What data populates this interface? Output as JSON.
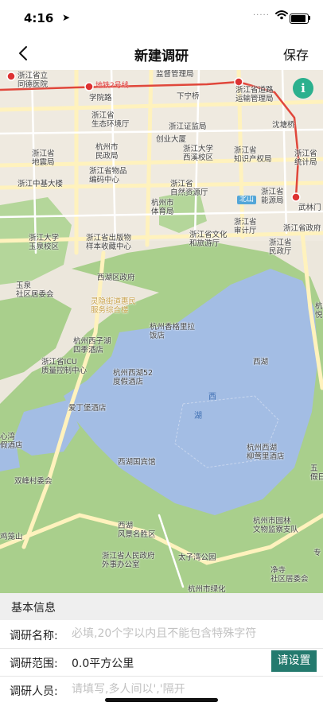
{
  "status_bar": {
    "time": "4:16",
    "location_arrow": "➤",
    "signal": "·····"
  },
  "nav": {
    "back_icon": "chevron-left-icon",
    "title": "新建调研",
    "save_label": "保存"
  },
  "map": {
    "info_label": "i",
    "labels": {
      "tongde": "浙江省立\n同德医院",
      "metro2": "地铁2号线",
      "jianguan": "监督管理局",
      "xuyuan": "学院路",
      "daolu": "浙江省道路\n运输管理局",
      "huanbao": "浙江省\n生态环境厅",
      "xianing": "下宁桥",
      "zhengjian": "浙江证监局",
      "shentang": "沈塘桥",
      "minzheng": "杭州市\n民政局",
      "chuangye": "创业大厦",
      "zju": "浙江大学\n西溪校区",
      "zhishi": "浙江省\n知识产权局",
      "tongji": "浙江省\n统计局",
      "dixiao": "浙江省\n地震局",
      "wuyi": "浙江省物品\n编码中心",
      "zhongji": "浙江中基大楼",
      "ziranziyuan": "浙江省\n自然资源厅",
      "beishan": "北山",
      "nengyuan": "浙江省\n能源局",
      "wulin": "武林门",
      "tiyu": "杭州市\n体育局",
      "shenji": "浙江省\n审计厅",
      "zhengfu": "浙江省政府",
      "yuquan": "浙江大学\n玉泉校区",
      "chuban": "浙江省出版物\n样本收藏中心",
      "wenhua": "浙江省文化\n和旅游厅",
      "minzhengting": "浙江省\n民政厅",
      "yuquan_comm": "玉泉\n社区居委会",
      "xihuqu": "西湖区政府",
      "lingyin": "灵隐街道惠民\n服务综合楼",
      "xiangge": "杭州香格里拉\n饭店",
      "sizi": "杭州西子湖\n四季酒店",
      "icu": "浙江省ICU\n质量控制中心",
      "yuan52": "杭州西湖52\n度假酒店",
      "xihu": "西湖",
      "aiding": "爱丁堡酒店",
      "xi": "西",
      "hu": "湖",
      "xinwan": "心湾\n假酒店",
      "guobin": "西湖国宾馆",
      "liuying": "杭州西湖\n柳莺里酒店",
      "wuyun": "五\n假日",
      "shuangfeng": "双峰村委会",
      "fengjing": "西湖\n风景名胜区",
      "yuanlin": "杭州市园林\n文物监察支队",
      "jiqi": "鸡笼山",
      "waishi": "浙江省人民政府\n外事办公室",
      "taiziwan": "太子湾公园",
      "jingci": "净寺\n社区居委会",
      "zhuan": "专",
      "lvhua": "杭州市绿化",
      "xihu_edge": "杭\n悦"
    }
  },
  "form": {
    "section_title": "基本信息",
    "name_label": "调研名称:",
    "name_placeholder": "必填,20个字以内且不能包含特殊字符",
    "range_label": "调研范围:",
    "range_value": "0.0平方公里",
    "set_label": "请设置",
    "people_label": "调研人员:",
    "people_placeholder": "请填写,多人间以','隔开"
  },
  "colors": {
    "accent": "#247a6e",
    "info": "#2bb08e",
    "lake": "#a3bde4",
    "park": "#a9cf8c",
    "land": "#e9e4d8",
    "road": "#fdeba8",
    "metro": "#e0473b"
  }
}
